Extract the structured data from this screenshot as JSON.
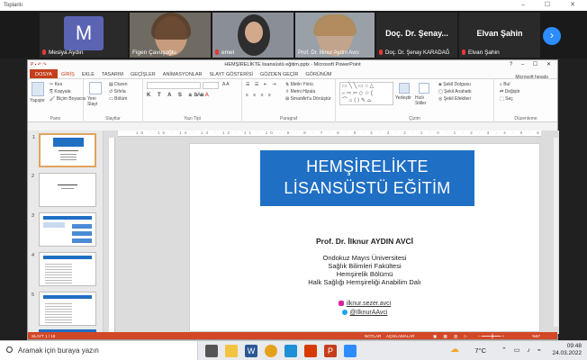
{
  "zoom": {
    "window_title": "Toplantı",
    "participants": [
      {
        "initial": "M",
        "name": "Mesiya Aydın"
      },
      {
        "name": "Figen Çavuşoğlu"
      },
      {
        "name": "emel"
      },
      {
        "name": "Prof. Dr. İlknur Aydın Avcı"
      },
      {
        "name": "Doç. Dr. Şenay KARADAĞ",
        "display": "Doç. Dr. Şenay..."
      },
      {
        "name": "Elvan Şahin",
        "display": "Elvan Şahin"
      }
    ]
  },
  "powerpoint": {
    "title": "HEMŞİRELİKTE lisansüstü eğitim.pptx - Microsoft PowerPoint",
    "tabs": [
      "DOSYA",
      "GİRİŞ",
      "EKLE",
      "TASARIM",
      "GEÇİŞLER",
      "ANİMASYONLAR",
      "SLAYT GÖSTERİSİ",
      "GÖZDEN GEÇİR",
      "GÖRÜNÜM"
    ],
    "account": "Microsoft hesabı",
    "ribbon": {
      "clipboard": {
        "paste": "Yapıştır",
        "cut": "Kes",
        "copy": "Kopyala",
        "format_painter": "Biçim Boyacısı",
        "label": "Pano"
      },
      "slides": {
        "new_slide": "Yeni Slayt",
        "layout": "Düzen",
        "reset": "Sıfırla",
        "section": "Bölüm",
        "label": "Slaytlar"
      },
      "font": {
        "label": "Yazı Tipi"
      },
      "paragraph": {
        "text_direction": "Metin Yönü",
        "align_text": "Metni Hizala",
        "smartart": "SmartArt'a Dönüştür",
        "label": "Paragraf"
      },
      "drawing": {
        "arrange": "Yerleştir",
        "quick_styles": "Hızlı Stiller",
        "shape_fill": "Şekil Dolgusu",
        "shape_outline": "Şekil Anahattı",
        "shape_effects": "Şekil Efektleri",
        "label": "Çizim"
      },
      "editing": {
        "find": "Bul",
        "replace": "Değiştir",
        "select": "Seç",
        "label": "Düzenleme"
      }
    },
    "thumbnail_numbers": [
      "1",
      "2",
      "3",
      "4",
      "5"
    ],
    "slide": {
      "title_line1": "HEMŞİRELİKTE",
      "title_line2": "LİSANSÜSTÜ EĞİTİM",
      "author": "Prof. Dr. İlknur AYDIN AVCİ",
      "institution": [
        "Ondokuz Mayıs Üniversitesi",
        "Sağlık Bilimleri Fakültesi",
        "Hemşirelik Bölümü",
        "Halk Sağlığı Hemşireliği Anabilim Dalı"
      ],
      "instagram": "ilknur.sezer.avci",
      "twitter": "@IlknurAAvci"
    },
    "status": {
      "slide": "SLAYT 1 / 18",
      "notes": "NOTLAR",
      "comments": "AÇIKLAMALAR",
      "zoom": "%67"
    }
  },
  "taskbar": {
    "search_placeholder": "Aramak için buraya yazın",
    "temperature": "7°C",
    "time": "09:48",
    "date": "24.03.2022"
  },
  "colors": {
    "ppt_accent": "#c43e1c",
    "slide_banner": "#1f6fc4",
    "zoom_blue": "#2d8cff"
  }
}
